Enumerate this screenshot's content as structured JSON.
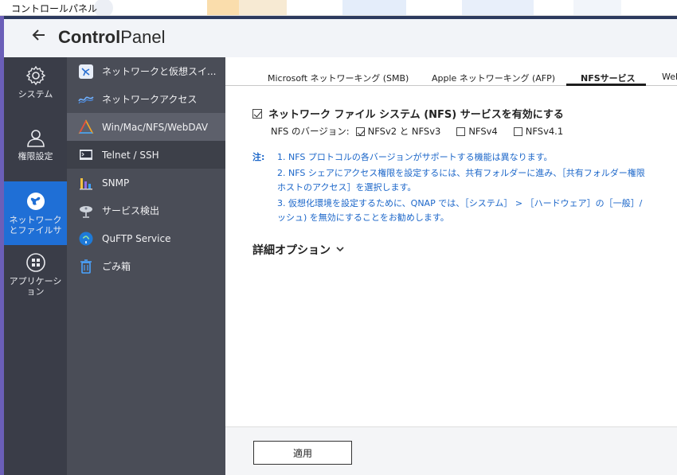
{
  "window": {
    "title": "コントロールパネル"
  },
  "header": {
    "back_icon": "arrow-left-icon",
    "brand_bold": "Control",
    "brand_light": "Panel"
  },
  "rail": {
    "items": [
      {
        "label": "システム",
        "icon": "gear-icon"
      },
      {
        "label": "権限設定",
        "icon": "user-icon"
      },
      {
        "label": "ネットワーク\nとファイルサ",
        "icon": "globe-icon",
        "active": true
      },
      {
        "label": "アプリケーシ\nョン",
        "icon": "apps-grid-icon"
      }
    ]
  },
  "subnav": {
    "items": [
      {
        "label": "ネットワークと仮想スイ...",
        "icon": "network-switch-icon"
      },
      {
        "label": "ネットワークアクセス",
        "icon": "wave-icon"
      },
      {
        "label": "Win/Mac/NFS/WebDAV",
        "icon": "triangle-colors-icon",
        "active": true
      },
      {
        "label": "Telnet / SSH",
        "icon": "terminal-icon"
      },
      {
        "label": "SNMP",
        "icon": "bar-chart-icon"
      },
      {
        "label": "サービス検出",
        "icon": "satellite-dish-icon"
      },
      {
        "label": "QuFTP Service",
        "icon": "ftp-globe-icon"
      },
      {
        "label": "ごみ箱",
        "icon": "trash-icon"
      }
    ]
  },
  "tabs": [
    {
      "label": "Microsoft ネットワーキング (SMB)"
    },
    {
      "label": "Apple ネットワーキング (AFP)"
    },
    {
      "label": "NFSサービス",
      "active": true
    },
    {
      "label": "Web"
    }
  ],
  "nfs": {
    "enable_label": "ネットワーク ファイル システム (NFS) サービスを有効にする",
    "enable_checked": true,
    "version_label": "NFS のバージョン:",
    "versions": [
      {
        "label": "NFSv2 と NFSv3",
        "checked": true
      },
      {
        "label": "NFSv4",
        "checked": false
      },
      {
        "label": "NFSv4.1",
        "checked": false
      }
    ]
  },
  "notes": {
    "label": "注:",
    "lines": [
      "1. NFS プロトコルの各バージョンがサポートする機能は異なります。",
      "2. NFS シェアにアクセス権限を設定するには、共有フォルダーに進み、［共有フォルダー権限",
      "ホストのアクセス］を選択します。",
      "3. 仮想化環境を設定するために、QNAP では、［システム］ > ［ハードウェア］の［一般］/",
      "ッシュ) を無効にすることをお勧めします。"
    ]
  },
  "advanced": {
    "label": "詳細オプション",
    "icon": "chevron-down-icon"
  },
  "footer": {
    "apply_label": "適用"
  }
}
